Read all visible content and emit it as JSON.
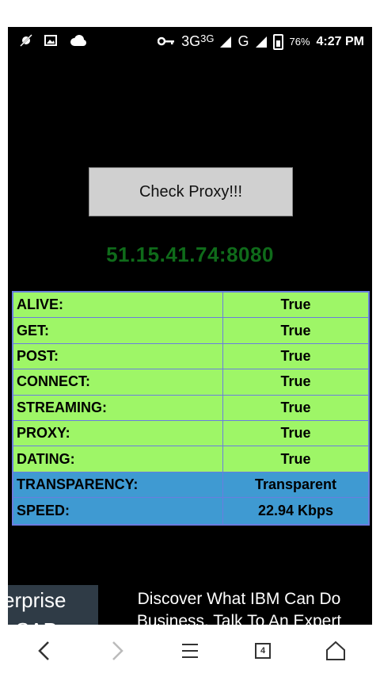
{
  "status_bar": {
    "network_1": "3G",
    "network_1_sup": "3G",
    "network_2": "G",
    "battery": "76%",
    "time": "4:27 PM"
  },
  "actions": {
    "check_label": "Check Proxy!!!"
  },
  "proxy": {
    "address": "51.15.41.74:8080"
  },
  "results": [
    {
      "label": "ALIVE:",
      "value": "True"
    },
    {
      "label": "GET:",
      "value": "True"
    },
    {
      "label": "POST:",
      "value": "True"
    },
    {
      "label": "CONNECT:",
      "value": "True"
    },
    {
      "label": "STREAMING:",
      "value": "True"
    },
    {
      "label": "PROXY:",
      "value": "True"
    },
    {
      "label": "DATING:",
      "value": "True"
    },
    {
      "label": "TRANSPARENCY:",
      "value": "Transparent"
    },
    {
      "label": "SPEED:",
      "value": "22.94 Kbps"
    }
  ],
  "ad": {
    "left_text": "erprise",
    "left_text_2": "r SAP",
    "right_line_1": "Discover What IBM Can Do",
    "right_line_2": "Business. Talk To An Expert"
  },
  "navbar": {
    "tabs_count": "4"
  },
  "colors": {
    "row_green": "#9ef667",
    "row_blue": "#3f9ad2",
    "address_green": "#0f6b1a"
  }
}
